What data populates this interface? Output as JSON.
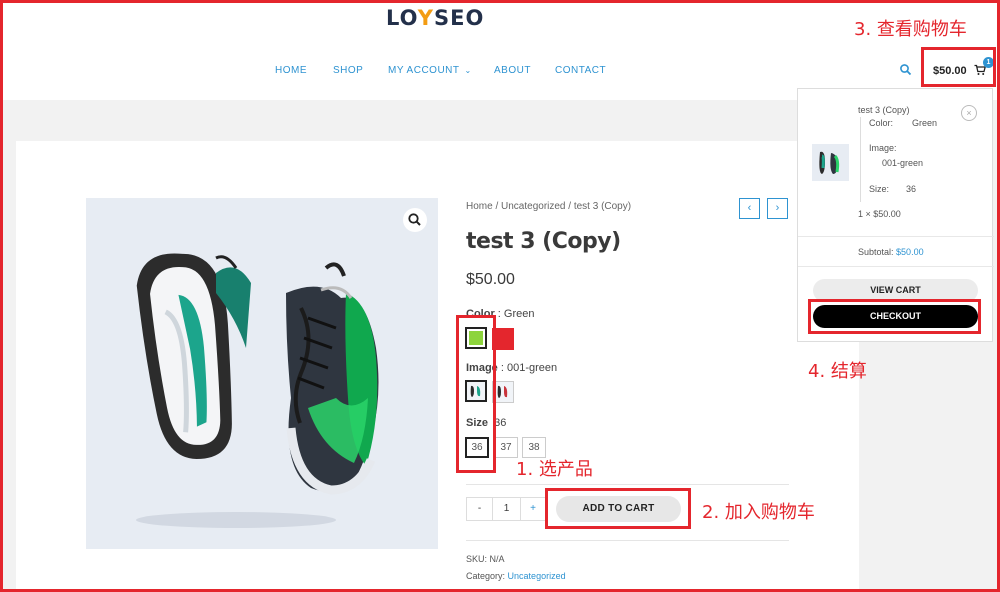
{
  "header": {
    "logo_left": "LO",
    "logo_mark": "Y",
    "logo_right": "SEO",
    "nav": [
      "HOME",
      "SHOP",
      "MY ACCOUNT",
      "ABOUT",
      "CONTACT"
    ],
    "cart_total": "$50.00",
    "cart_count": "1"
  },
  "product": {
    "breadcrumb": "Home / Uncategorized / test 3 (Copy)",
    "prev_icon": "‹",
    "next_icon": "›",
    "title": "test 3 (Copy)",
    "price": "$50.00",
    "color_label": "Color",
    "color_value": ": Green",
    "colors": [
      "#8dd43c",
      "#e4262d"
    ],
    "image_label": "Image",
    "image_value": ": 001-green",
    "size_label": "Size",
    "size_value": "36",
    "sizes": [
      "36",
      "37",
      "38"
    ],
    "qty_minus": "-",
    "qty_value": "1",
    "qty_plus": "+",
    "add_to_cart": "ADD TO CART",
    "sku_label": "SKU:",
    "sku_value": "N/A",
    "category_label": "Category:",
    "category_value": "Uncategorized"
  },
  "mini_cart": {
    "item_name": "test 3 (Copy)",
    "close_icon": "×",
    "color_label": "Color:",
    "color_value": "Green",
    "image_label": "Image:",
    "image_value": "001-green",
    "size_label": "Size:",
    "size_value": "36",
    "qty_line": "1 × $50.00",
    "subtotal_label": "Subtotal:",
    "subtotal_value": "$50.00",
    "view_cart": "VIEW CART",
    "checkout": "CHECKOUT"
  },
  "annotations": {
    "step1": "1. 选产品",
    "step2": "2. 加入购物车",
    "step3": "3. 查看购物车",
    "step4": "4. 结算"
  },
  "colors": {
    "accent": "#2e93d1",
    "annotation": "#e4262d",
    "logo_orange": "#f39c12"
  }
}
